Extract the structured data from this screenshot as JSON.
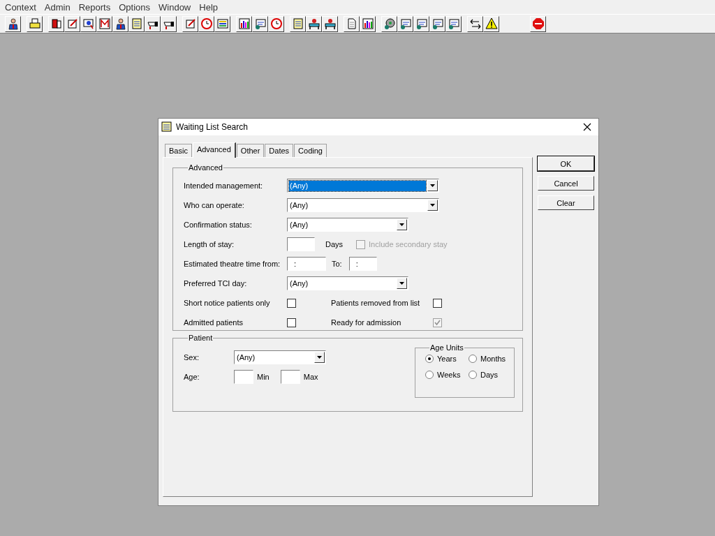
{
  "menu": [
    "Context",
    "Admin",
    "Reports",
    "Options",
    "Window",
    "Help"
  ],
  "dialog": {
    "title": "Waiting List Search",
    "tabs": [
      {
        "label": "Basic",
        "selected": false
      },
      {
        "label": "Advanced",
        "selected": true
      },
      {
        "label": "Other",
        "selected": false
      },
      {
        "label": "Dates",
        "selected": false
      },
      {
        "label": "Coding",
        "selected": false
      }
    ],
    "advanced": {
      "legend": "Advanced",
      "rows": [
        {
          "kind": "dropdown",
          "label": "Intended management:",
          "value": "(Any)",
          "wide": true,
          "highlighted": true
        },
        {
          "kind": "dropdown",
          "label": "Who can operate:",
          "value": "(Any)",
          "wide": true,
          "highlighted": false
        },
        {
          "kind": "dropdown",
          "label": "Confirmation status:",
          "value": "(Any)",
          "wide": false,
          "highlighted": false
        },
        {
          "kind": "stay",
          "label": "Length of stay:",
          "unit": "Days",
          "check": {
            "label": "Include secondary stay",
            "checked": false,
            "disabled": true
          }
        },
        {
          "kind": "time",
          "label": "Estimated theatre time from:",
          "from": ":",
          "to_label": "To:",
          "to": ":"
        },
        {
          "kind": "dropdown",
          "label": "Preferred TCI day:",
          "value": "(Any)",
          "wide": false,
          "highlighted": false
        },
        {
          "kind": "checks",
          "items": [
            {
              "label": "Short notice patients only",
              "checked": false,
              "disabled": false
            },
            {
              "label": "Patients removed from list",
              "checked": false,
              "disabled": false
            }
          ]
        },
        {
          "kind": "checks",
          "items": [
            {
              "label": "Admitted patients",
              "checked": false,
              "disabled": false
            },
            {
              "label": "Ready for admission",
              "checked": true,
              "disabled": true
            }
          ]
        }
      ]
    },
    "patient": {
      "legend": "Patient",
      "sex": {
        "label": "Sex:",
        "value": "(Any)"
      },
      "age": {
        "label": "Age:",
        "min_label": "Min",
        "max_label": "Max"
      },
      "age_units": {
        "legend": "Age Units",
        "options": [
          {
            "label": "Years",
            "selected": true
          },
          {
            "label": "Months",
            "selected": false
          },
          {
            "label": "Weeks",
            "selected": false
          },
          {
            "label": "Days",
            "selected": false
          }
        ]
      }
    },
    "buttons": [
      {
        "label": "OK",
        "default": true
      },
      {
        "label": "Cancel",
        "default": false
      },
      {
        "label": "Clear",
        "default": false
      }
    ]
  }
}
